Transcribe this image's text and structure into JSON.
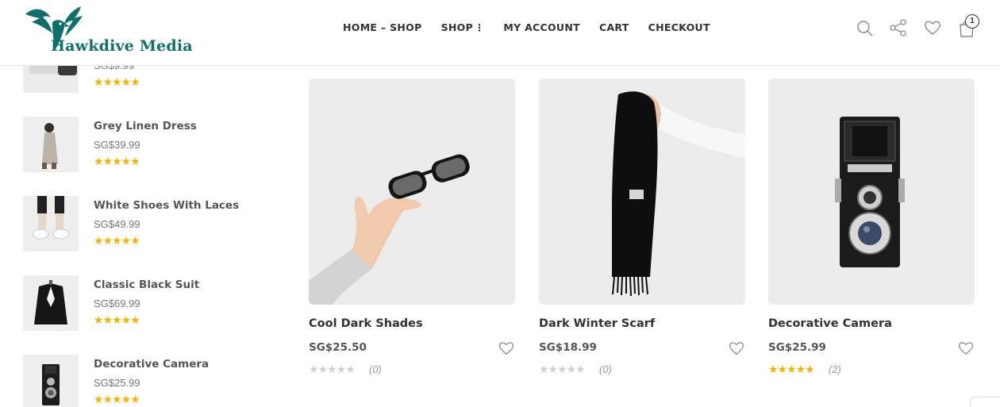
{
  "brand": {
    "name": "Hawkdive Media",
    "color": "#0f6f6a"
  },
  "nav": [
    {
      "label": "HOME – SHOP"
    },
    {
      "label": "SHOP"
    },
    {
      "label": "MY ACCOUNT"
    },
    {
      "label": "CART"
    },
    {
      "label": "CHECKOUT"
    }
  ],
  "nav_more_glyph": "⋮",
  "header_icons": [
    "search-icon",
    "share-icon",
    "heart-icon",
    "shopping-bag-icon"
  ],
  "cart": {
    "count": "1"
  },
  "sidebar": {
    "items": [
      {
        "name": "",
        "price": "SG$9.99",
        "stars": "★★★★★"
      },
      {
        "name": "Grey Linen Dress",
        "price": "SG$39.99",
        "stars": "★★★★★"
      },
      {
        "name": "White Shoes With Laces",
        "price": "SG$49.99",
        "stars": "★★★★★"
      },
      {
        "name": "Classic Black Suit",
        "price": "SG$69.99",
        "stars": "★★★★★"
      },
      {
        "name": "Decorative Camera",
        "price": "SG$25.99",
        "stars": "★★★★★"
      }
    ]
  },
  "products": [
    {
      "name": "Cool Dark Shades",
      "price": "SG$25.50",
      "stars": "★★★★★",
      "rating_count": "(0)",
      "rated": false
    },
    {
      "name": "Dark Winter Scarf",
      "price": "SG$18.99",
      "stars": "★★★★★",
      "rating_count": "(0)",
      "rated": false
    },
    {
      "name": "Decorative Camera",
      "price": "SG$25.99",
      "stars": "★★★★★",
      "rating_count": "(2)",
      "rated": true
    }
  ],
  "colors": {
    "star": "#f5b301",
    "star_empty": "#d0d0d0",
    "accent": "#0f6f6a"
  }
}
